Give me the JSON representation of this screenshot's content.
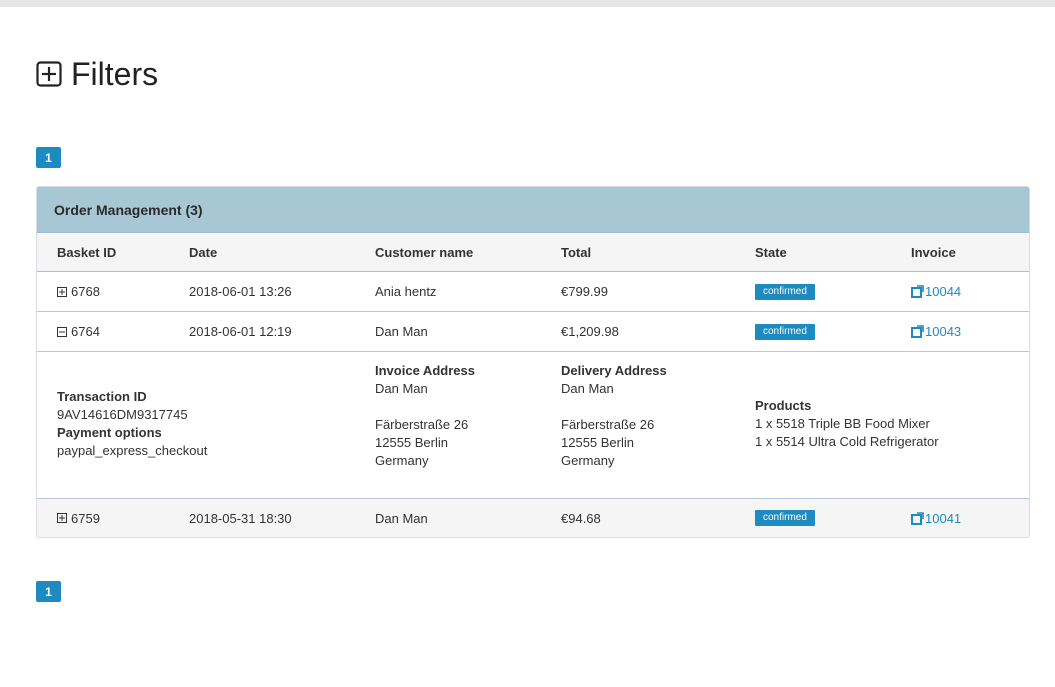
{
  "filters": {
    "label": "Filters"
  },
  "pagination": {
    "page": "1"
  },
  "panel": {
    "title": "Order Management (3)"
  },
  "table": {
    "headers": [
      "Basket ID",
      "Date",
      "Customer name",
      "Total",
      "State",
      "Invoice"
    ],
    "rows": [
      {
        "basket_id": "6768",
        "expanded": false,
        "date": "2018-06-01 13:26",
        "customer": "Ania hentz",
        "total": "€799.99",
        "state": "confirmed",
        "invoice": "10044"
      },
      {
        "basket_id": "6764",
        "expanded": true,
        "date": "2018-06-01 12:19",
        "customer": "Dan Man",
        "total": "€1,209.98",
        "state": "confirmed",
        "invoice": "10043"
      },
      {
        "basket_id": "6759",
        "expanded": false,
        "date": "2018-05-31 18:30",
        "customer": "Dan Man",
        "total": "€94.68",
        "state": "confirmed",
        "invoice": "10041"
      }
    ]
  },
  "details": {
    "transaction_label": "Transaction ID",
    "transaction_id": "9AV14616DM9317745",
    "payment_label": "Payment options",
    "payment_value": "paypal_express_checkout",
    "invoice_address": {
      "label": "Invoice Address",
      "name": "Dan Man",
      "street": "Färberstraße 26",
      "city": "12555 Berlin",
      "country": "Germany"
    },
    "delivery_address": {
      "label": "Delivery Address",
      "name": "Dan Man",
      "street": "Färberstraße 26",
      "city": "12555 Berlin",
      "country": "Germany"
    },
    "products": {
      "label": "Products",
      "items": [
        "1 x 5518 Triple BB Food Mixer",
        "1 x 5514 Ultra Cold Refrigerator"
      ]
    }
  },
  "colors": {
    "accent": "#1d8bbf",
    "panel_header": "#a8c7d4",
    "top_bar": "#e6e6e6"
  }
}
